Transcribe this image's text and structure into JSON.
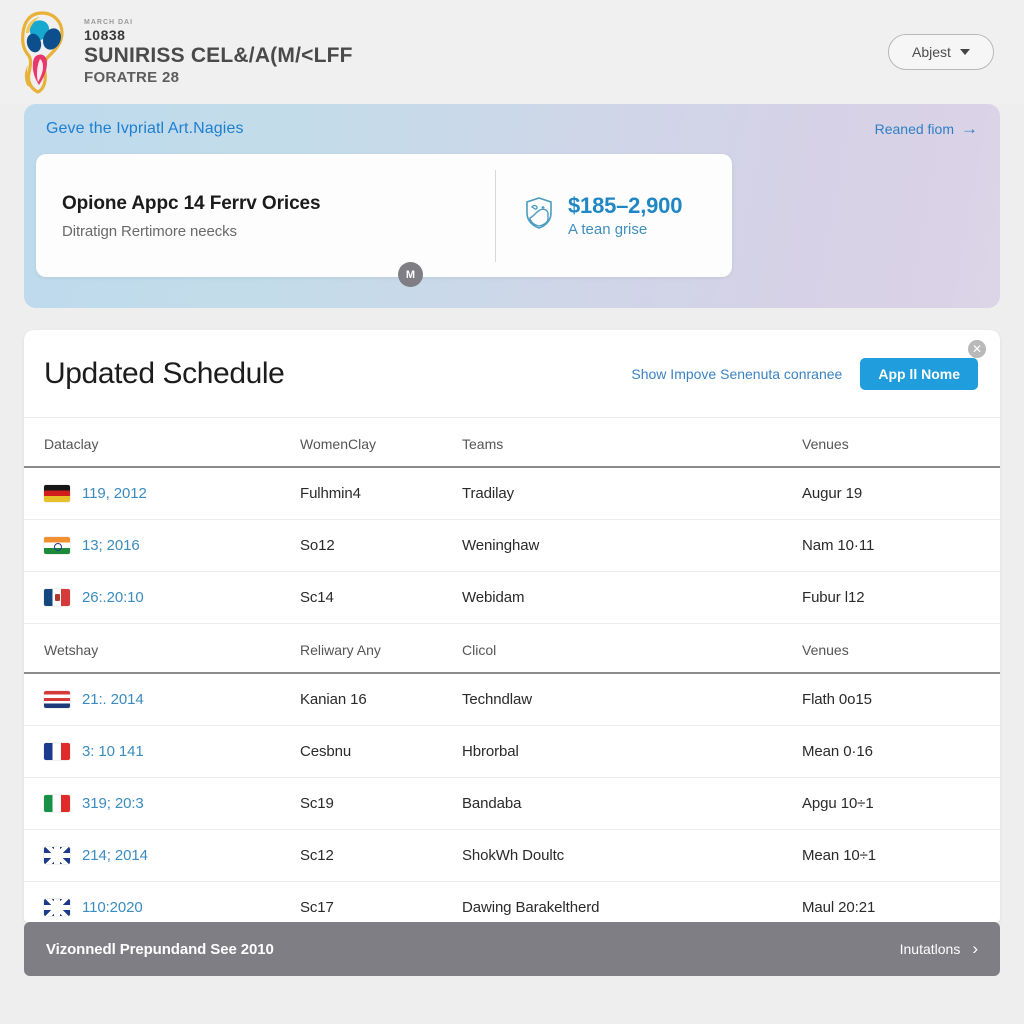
{
  "header": {
    "logo_icon": "world-cup-trophy-logo",
    "tiny_label": "MARCH DAI",
    "number": "10838",
    "title": "SUNIRISS CEL&/A(M/<LFF",
    "subtitle": "FORATRE 28",
    "adjust_button": "Abjest",
    "caret_icon": "chevron-down-icon"
  },
  "banner": {
    "title": "Geve the Ivpriatl Art.Nagies",
    "link": "Reaned fiom",
    "link_icon": "arrow-right-icon",
    "card": {
      "heading": "Opione Appc 14 Ferrv Orices",
      "subheading": "Ditratign Rertimore neecks",
      "shield_icon": "shield-icon",
      "price": "$185–2,900",
      "price_label": "A tean grise",
      "badge": "M"
    },
    "gradient_from": "#bedaec",
    "gradient_to": "#dcd4e7"
  },
  "panel": {
    "title": "Updated Schedule",
    "link": "Show Impove Senenuta conranee",
    "button": "App ll Nome",
    "close_icon": "close-icon",
    "accent_color": "#1f9ddc",
    "sections": [
      {
        "headers": [
          "Dataclay",
          "WomenClay",
          "Teams",
          "Venues"
        ],
        "rows": [
          {
            "flag": "de",
            "date": "119, 2012",
            "women": "Fulhmin4",
            "team": "Tradilay",
            "venue": "Augur 19"
          },
          {
            "flag": "in",
            "date": "13; 2016",
            "women": "So12",
            "team": "Weninghaw",
            "venue": "Nam 10·11"
          },
          {
            "flag": "mx",
            "date": "26:.20:10",
            "women": "Sc14",
            "team": "Webidam",
            "venue": "Fubur l12"
          }
        ]
      },
      {
        "headers": [
          "Wetshay",
          "Reliwary Any",
          "Clicol",
          "Venues"
        ],
        "rows": [
          {
            "flag": "nl",
            "date": "21:. 2014",
            "women": "Kanian 16",
            "team": "Techndlaw",
            "venue": "Flath 0o15"
          },
          {
            "flag": "fr",
            "date": "3: 10 141",
            "women": "Cesbnu",
            "team": "Hbrorbal",
            "venue": "Mean 0·16"
          },
          {
            "flag": "it",
            "date": "319; 20:3",
            "women": "Sc19",
            "team": "Bandaba",
            "venue": "Apgu 10÷1"
          },
          {
            "flag": "gb",
            "date": "214; 2014",
            "women": "Sc12",
            "team": "ShokWh Doultc",
            "venue": "Mean 10÷1"
          },
          {
            "flag": "gb",
            "date": "110:2020",
            "women": "Sc17",
            "team": "Dawing Barakeltherd",
            "venue": "Maul 20:21"
          }
        ]
      }
    ]
  },
  "footer": {
    "text": "Vizonnedl Prepundand See 2010",
    "link": "Inutatlons",
    "chevron_icon": "chevron-right-icon"
  }
}
